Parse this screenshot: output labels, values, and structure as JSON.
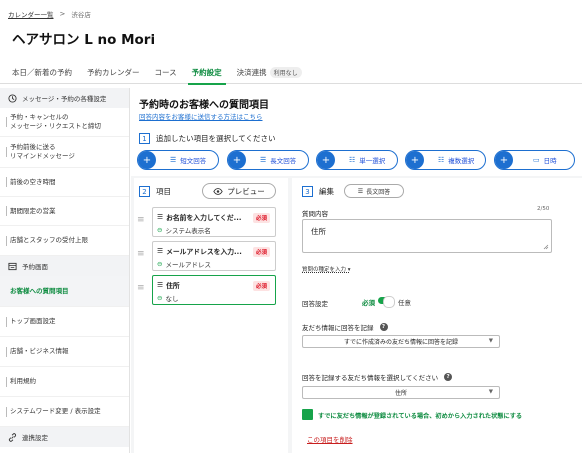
{
  "breadcrumb": {
    "parent": "カレンダー一覧",
    "separator": ">",
    "current": "渋谷店"
  },
  "shop": {
    "title": "ヘアサロン L no Mori"
  },
  "tabs": [
    {
      "label": "本日／新着の予約"
    },
    {
      "label": "予約カレンダー"
    },
    {
      "label": "コース"
    },
    {
      "label": "予約設定",
      "active": true
    },
    {
      "label": "決済連携",
      "badge": "利用なし"
    }
  ],
  "sidebar": {
    "sections": [
      {
        "label": "メッセージ・予約の各種設定",
        "icon": "clock-icon"
      },
      {
        "label": "予約画面",
        "icon": "layout-icon"
      },
      {
        "label": "連携設定",
        "icon": "link-icon"
      }
    ],
    "items": [
      {
        "label_line1": "予約・キャンセルの",
        "label_line2": "メッセージ・リクエストと締切"
      },
      {
        "label_line1": "予約前後に送る",
        "label_line2": "リマインドメッセージ"
      },
      {
        "label_line1": "前後の空き時間"
      },
      {
        "label_line1": "期間限定の営業"
      },
      {
        "label_line1": "店舗とスタッフの受付上限"
      },
      {
        "label_line1": "お客様への質問項目",
        "active": true
      },
      {
        "label_line1": "トップ画面設定"
      },
      {
        "label_line1": "店舗・ビジネス情報"
      },
      {
        "label_line1": "利用規約"
      },
      {
        "label_line1": "システムワード変更 / 表示設定"
      }
    ]
  },
  "main": {
    "title": "予約時のお客様への質問項目",
    "help_link": "回答内容をお客様に送信する方法はこちら",
    "step1": {
      "num": "1",
      "label": "追加したい項目を選択してください"
    },
    "add_buttons": [
      {
        "label": "短文回答",
        "icon": "short-text-icon"
      },
      {
        "label": "長文回答",
        "icon": "long-text-icon"
      },
      {
        "label": "単一選択",
        "icon": "single-choice-icon"
      },
      {
        "label": "複数選択",
        "icon": "multi-choice-icon"
      },
      {
        "label": "日時",
        "icon": "calendar-icon"
      }
    ],
    "step2": {
      "num": "2",
      "label": "項目",
      "preview_label": "プレビュー"
    },
    "questions": [
      {
        "title": "お名前を入力してくだ...",
        "required": "必須",
        "sub": "システム表示名",
        "icon": "short-text-icon"
      },
      {
        "title": "メールアドレスを入力...",
        "required": "必須",
        "sub": "メールアドレス",
        "icon": "short-text-icon"
      },
      {
        "title": "住所",
        "required": "必須",
        "sub": "なし",
        "icon": "long-text-icon",
        "selected": true
      }
    ],
    "step3": {
      "num": "3",
      "label": "編集",
      "type_tag": "長文回答"
    },
    "editor": {
      "content_label": "質問内容",
      "counter": "2/50",
      "content_value": "住所",
      "advanced_link": "質問の種定を入力",
      "answer_setting_label": "回答設定",
      "required_label": "必須",
      "optional_label": "任意",
      "required_on": true,
      "friend_record_label": "友だち情報に回答を記録",
      "friend_record_value": "すでに作成済みの友だち情報に回答を記録",
      "friend_field_label": "回答を記録する友だち情報を選択してください",
      "friend_field_value": "住所",
      "prefill_label": "すでに友だち情報が登録されている場合、初めから入力された状態にする",
      "prefill_checked": true,
      "delete_link": "この項目を削除"
    }
  },
  "colors": {
    "accent": "#16a34a",
    "link": "#1d6fd0",
    "danger": "#c81e1e"
  }
}
